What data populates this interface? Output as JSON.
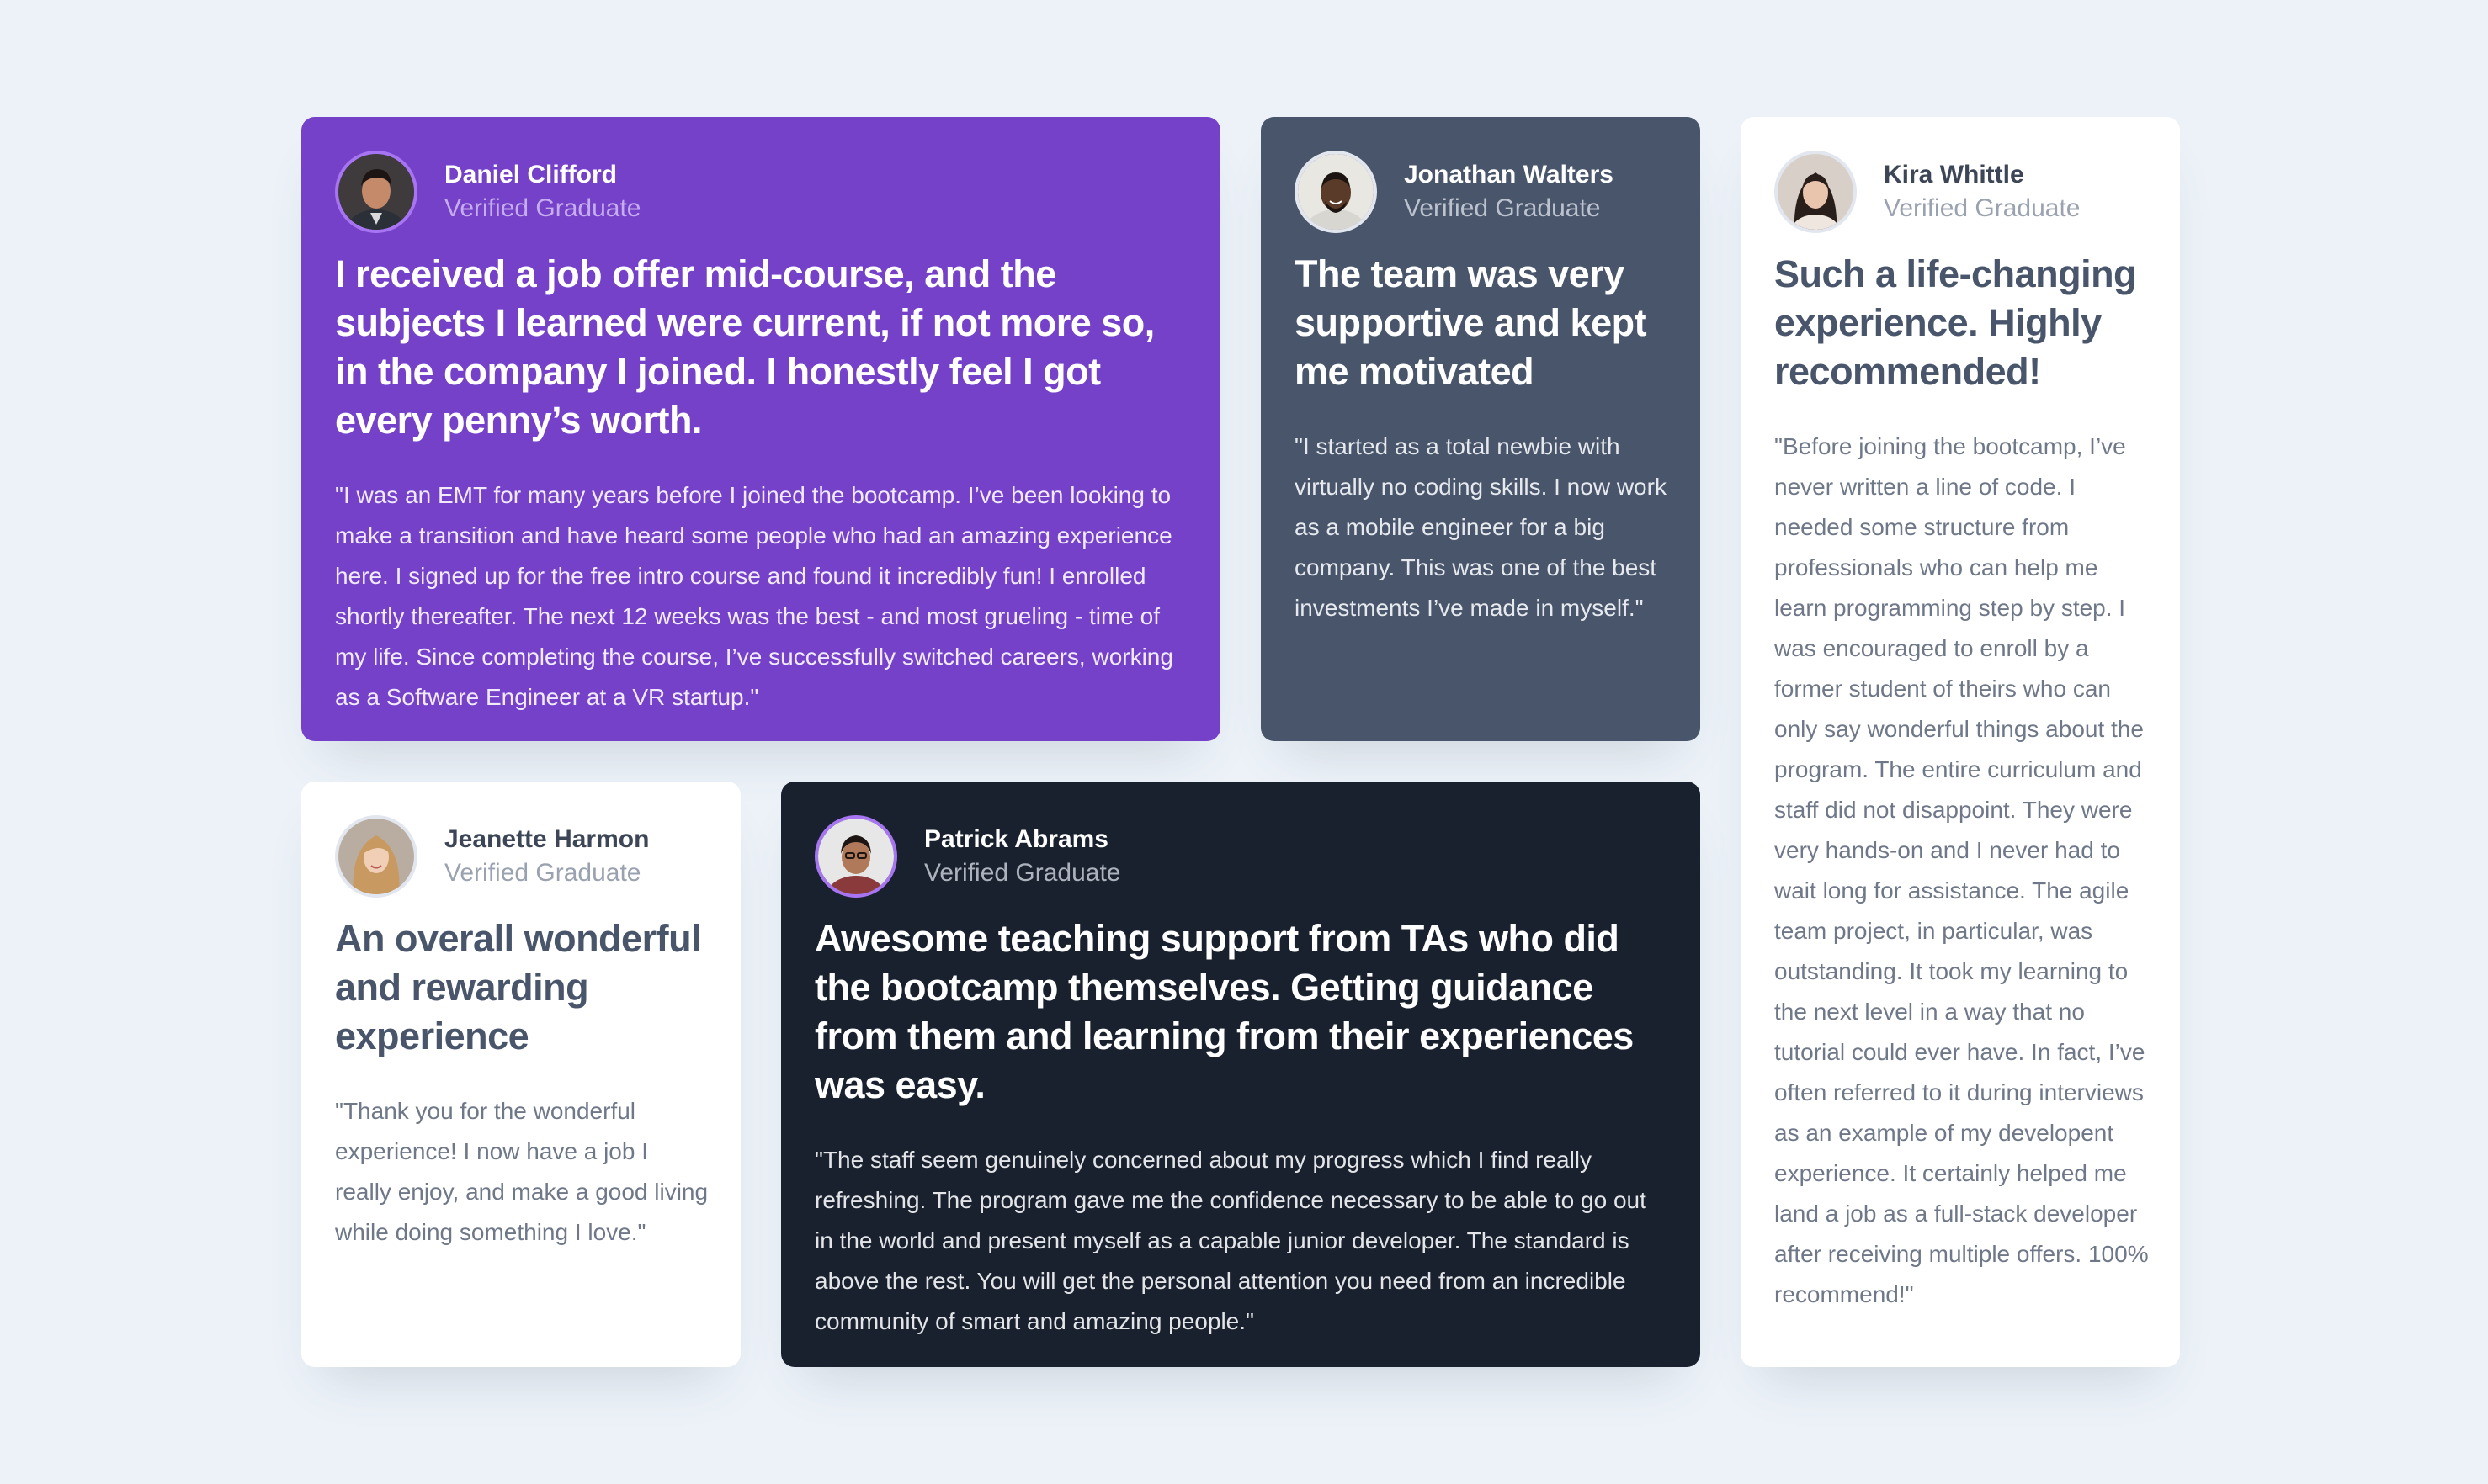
{
  "testimonials": [
    {
      "name": "Daniel Clifford",
      "role": "Verified Graduate",
      "avatar": "avatar-photo",
      "headline": "I received a job offer mid-course, and the subjects I learned were current, if not more so, in the company I joined. I honestly feel I got every penny’s worth.",
      "quote": "\"I was an EMT for many years before I joined the bootcamp. I’ve been looking to make a transition and have heard some people who had an amazing experience here. I signed up for the free intro course and found it incredibly fun! I enrolled shortly thereafter. The next 12 weeks was the best - and most grueling - time of my life. Since completing the course, I’ve successfully switched careers, working as a Software Engineer at a VR startup.\""
    },
    {
      "name": "Jonathan Walters",
      "role": "Verified Graduate",
      "avatar": "avatar-photo",
      "headline": "The team was very supportive and kept me motivated",
      "quote": "\"I started as a total newbie with virtually no coding skills. I now work as a mobile engineer for a big company. This was one of the best investments I’ve made in myself.\""
    },
    {
      "name": "Kira Whittle",
      "role": "Verified Graduate",
      "avatar": "avatar-photo",
      "headline": "Such a life-changing experience. Highly recommended!",
      "quote": "\"Before joining the bootcamp, I’ve never written a line of code. I needed some structure from professionals who can help me learn programming step by step. I was encouraged to enroll by a former student of theirs who can only say wonderful things about the program. The entire curriculum and staff did not disappoint. They were very hands-on and I never had to wait long for assistance. The agile team project, in particular, was outstanding. It took my learning to the next level in a way that no tutorial could ever have. In fact, I’ve often referred to it during interviews as an example of my developent experience. It certainly helped me land a job as a full-stack developer after receiving multiple offers. 100% recommend!\""
    },
    {
      "name": "Jeanette Harmon",
      "role": "Verified Graduate",
      "avatar": "avatar-photo",
      "headline": "An overall wonderful and rewarding experience",
      "quote": "\"Thank you for the wonderful experience! I now have a job I really enjoy, and make a good living while doing something I love.\""
    },
    {
      "name": "Patrick Abrams",
      "role": "Verified Graduate",
      "avatar": "avatar-photo",
      "headline": "Awesome teaching support from TAs who did the bootcamp themselves. Getting guidance from them and learning from their experiences was easy.",
      "quote": "\"The staff seem genuinely concerned about my progress which I find really refreshing. The program gave me the confidence necessary to be able to go out in the world and present myself as a capable junior developer. The standard is above the rest. You will get the personal attention you need from an incredible community of smart and amazing people.\""
    }
  ],
  "colors": {
    "page_background": "#ecf2f8",
    "purple": "#7541c8",
    "slate": "#48556a",
    "white": "#ffffff",
    "dark": "#19212e"
  }
}
